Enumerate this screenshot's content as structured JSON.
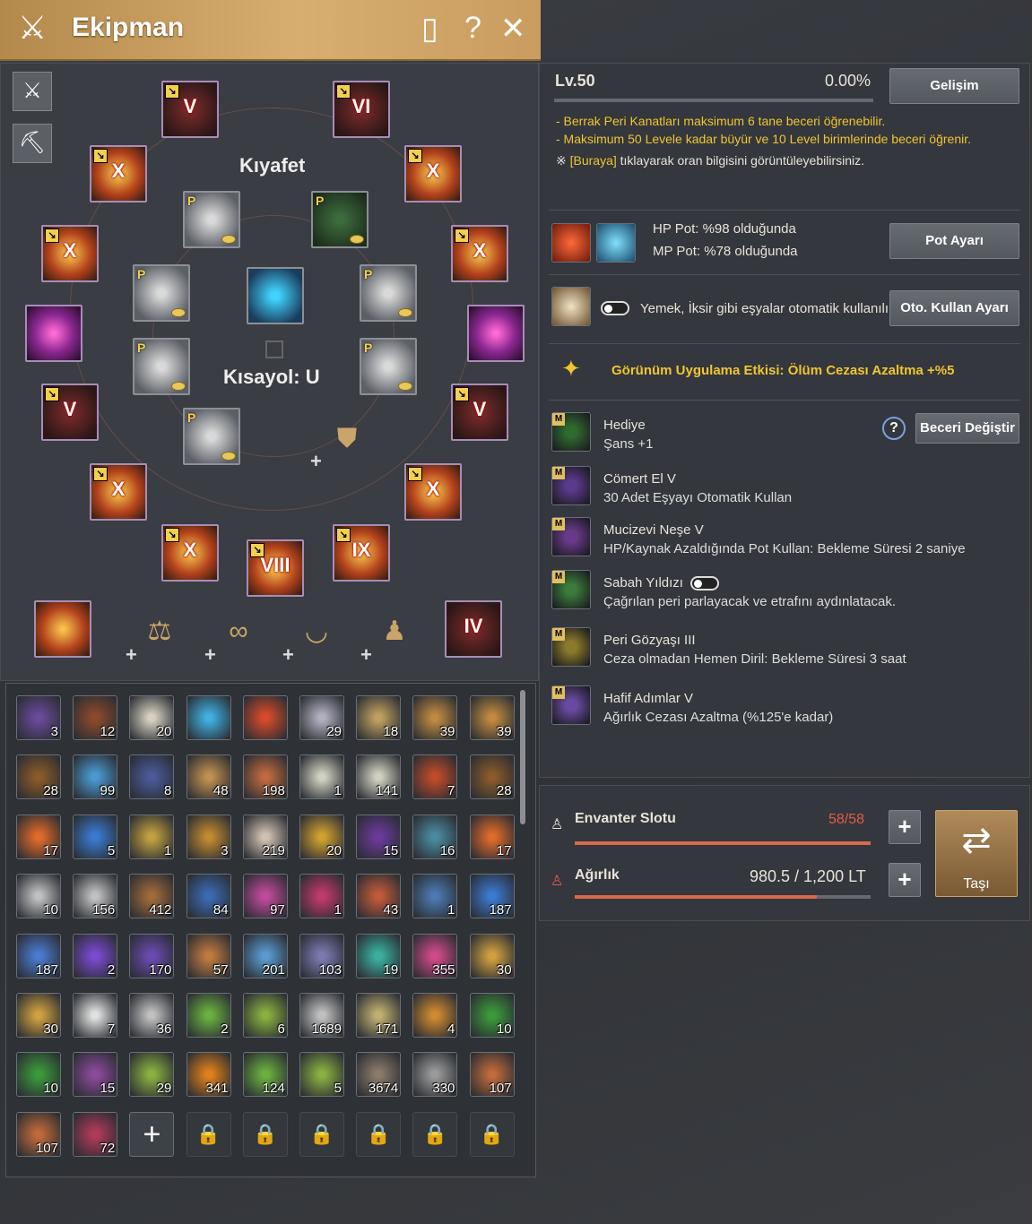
{
  "header": {
    "title": "Ekipman",
    "icons": [
      "notebook-icon",
      "help-icon",
      "close-icon"
    ]
  },
  "equip": {
    "label_outfit": "Kıyafet",
    "label_shortcut": "Kısayol: U",
    "slots": [
      "V",
      "VI",
      "X",
      "X",
      "X",
      "X",
      "V",
      "V",
      "X",
      "X",
      "X",
      "VIII",
      "IX",
      "IV"
    ]
  },
  "skill": {
    "level": "Lv.50",
    "percent": "0.00%",
    "develop_btn": "Gelişim",
    "note1": "- Berrak Peri Kanatları maksimum 6 tane beceri öğrenebilir.",
    "note2": "- Maksimum 50 Levele kadar büyür ve 10 Level birimlerinde beceri öğrenir.",
    "note3_prefix": "※ ",
    "note3_link": "[Buraya]",
    "note3_suffix": " tıklayarak oran bilgisini görüntüleyebilirsiniz."
  },
  "potion": {
    "hp": "HP Pot: %98 olduğunda",
    "mp": "MP Pot: %78 olduğunda",
    "btn": "Pot Ayarı"
  },
  "auto": {
    "label": "Yemek, İksir gibi eşyalar otomatik kullanılır.",
    "btn": "Oto. Kullan Ayarı"
  },
  "appearance": {
    "text": "Görünüm Uygulama Etkisi: Ölüm Cezası Azaltma +%5"
  },
  "skills": {
    "change_btn": "Beceri Değiştir",
    "help": "?",
    "list": [
      {
        "name": "Hediye",
        "desc": "Şans +1"
      },
      {
        "name": "Cömert El V",
        "desc": "30 Adet Eşyayı Otomatik Kullan"
      },
      {
        "name": "Mucizevi Neşe V",
        "desc": "HP/Kaynak Azaldığında Pot Kullan: Bekleme Süresi 2 saniye"
      },
      {
        "name": "Sabah Yıldızı",
        "desc": "Çağrılan peri parlayacak ve etrafını aydınlatacak."
      },
      {
        "name": "Peri Gözyaşı III",
        "desc": "Ceza olmadan Hemen Diril: Bekleme Süresi 3 saat"
      },
      {
        "name": "Hafif Adımlar V",
        "desc": "Ağırlık Cezası Azaltma (%125'e kadar)"
      }
    ]
  },
  "inventory": {
    "slot_label": "Envanter Slotu",
    "slot_value": "58/58",
    "weight_label": "Ağırlık",
    "weight_value": "980.5 / 1,200 LT",
    "move_btn": "Taşı",
    "slot_fill": 1.0,
    "weight_fill": 0.817,
    "counts": [
      "3",
      "12",
      "20",
      "",
      "",
      "29",
      "18",
      "39",
      "39",
      "28",
      "99",
      "8",
      "48",
      "198",
      "1",
      "141",
      "7",
      "28",
      "17",
      "5",
      "1",
      "3",
      "219",
      "20",
      "15",
      "16",
      "17",
      "10",
      "156",
      "412",
      "84",
      "97",
      "1",
      "43",
      "1",
      "187",
      "187",
      "2",
      "170",
      "57",
      "201",
      "103",
      "19",
      "355",
      "30",
      "30",
      "7",
      "36",
      "2",
      "6",
      "1689",
      "171",
      "4",
      "10",
      "10",
      "15",
      "29",
      "341",
      "124",
      "5",
      "3674",
      "330",
      "107",
      "107",
      "72"
    ]
  }
}
